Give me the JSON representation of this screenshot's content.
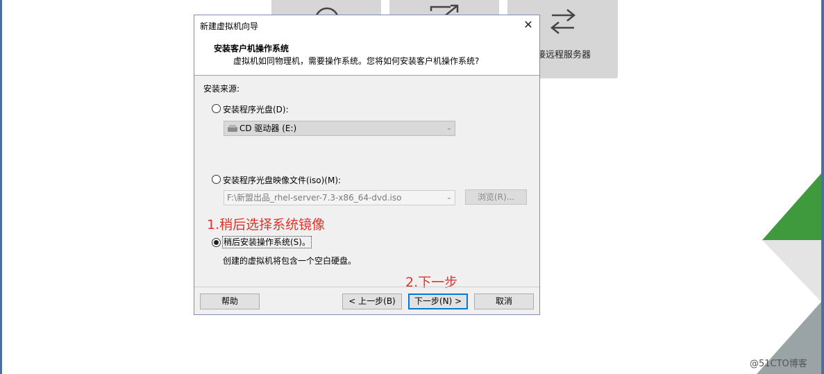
{
  "background": {
    "tile3_label": "接远程服务器",
    "watermark": "@51CTO博客"
  },
  "dialog": {
    "title": "新建虚拟机向导",
    "close_glyph": "✕",
    "heading": "安装客户机操作系统",
    "subheading": "虚拟机如同物理机，需要操作系统。您将如何安装客户机操作系统?",
    "source_label": "安装来源:",
    "option_disc_label": "安装程序光盘(D):",
    "disc_select_value": "CD 驱动器 (E:)",
    "option_iso_label": "安装程序光盘映像文件(iso)(M):",
    "iso_path_value": "F:\\新盟出品_rhel-server-7.3-x86_64-dvd.iso",
    "browse_label": "浏览(R)...",
    "option_later_label": "稍后安装操作系统(S)。",
    "later_description": "创建的虚拟机将包含一个空白硬盘。",
    "selected_option": "later",
    "buttons": {
      "help": "帮助",
      "back": "< 上一步(B)",
      "next": "下一步(N) >",
      "cancel": "取消"
    }
  },
  "annotations": {
    "step1": "1.稍后选择系统镜像",
    "step2": "2.下一步"
  },
  "colors": {
    "annotation": "#e0332b",
    "brand_green": "#3f9a3e",
    "primary_button_border": "#0078d7"
  }
}
